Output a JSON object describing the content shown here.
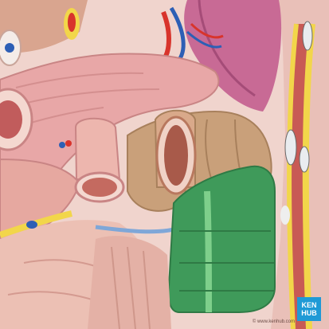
{
  "logo": {
    "line1": "KEN",
    "line2": "HUB"
  },
  "credit": "© www.kenhub.com",
  "colors": {
    "background": "#f3dcd6",
    "pancreas": "#e8a7a7",
    "colon": "#c9a07a",
    "descending_colon": "#3f9a5a",
    "abdominal_wall_muscle": "#c85a55",
    "fat": "#f2d64a",
    "kidney": "#c86a95",
    "vessel_artery": "#d8342c",
    "vessel_vein": "#2d5fb5",
    "brand": "#1f9ad6"
  }
}
